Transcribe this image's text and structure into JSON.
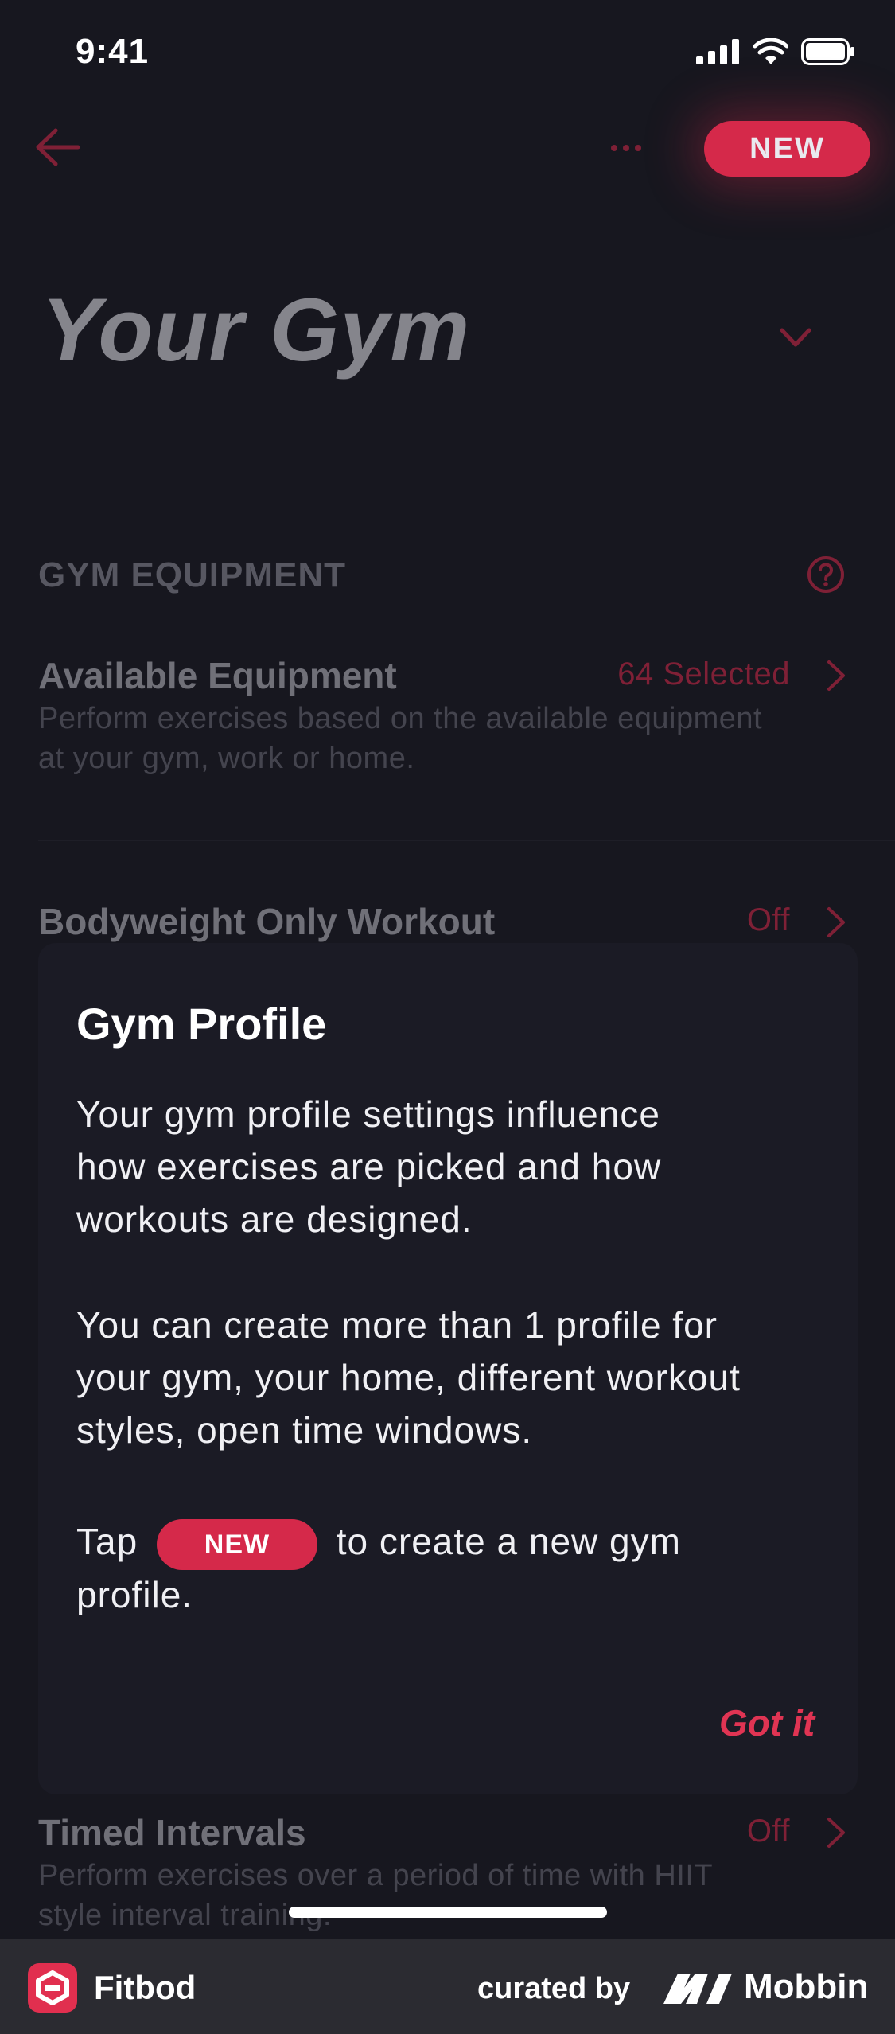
{
  "status_bar": {
    "time": "9:41"
  },
  "header": {
    "new_button": "NEW"
  },
  "page": {
    "title": "Your Gym"
  },
  "gym_equipment": {
    "section_label": "GYM EQUIPMENT",
    "available": {
      "title": "Available Equipment",
      "value": "64 Selected",
      "desc_line1": "Perform exercises based on the available equipment",
      "desc_line2": "at your gym, work or home."
    },
    "bodyweight": {
      "title": "Bodyweight Only Workout",
      "value": "Off"
    },
    "timed": {
      "title": "Timed Intervals",
      "value": "Off",
      "desc_line1": "Perform exercises over a period of time with HIIT",
      "desc_line2": "style interval training."
    }
  },
  "modal": {
    "title": "Gym Profile",
    "p1_l1": "Your gym profile settings influence",
    "p1_l2": "how exercises are picked and how",
    "p1_l3": "workouts are designed.",
    "p2_l1": "You can create more than 1 profile for",
    "p2_l2": "your gym, your home, different workout",
    "p2_l3": "styles, open time windows.",
    "p3_pre": "Tap",
    "p3_pill": "NEW",
    "p3_post": "to create a new gym",
    "p3_l2": "profile.",
    "confirm": "Got it"
  },
  "footer": {
    "app_name": "Fitbod",
    "curated_by": "curated by",
    "brand": "Mobbin"
  },
  "colors": {
    "accent": "#d5294a",
    "background": "#17171f",
    "card": "#1b1b25"
  }
}
